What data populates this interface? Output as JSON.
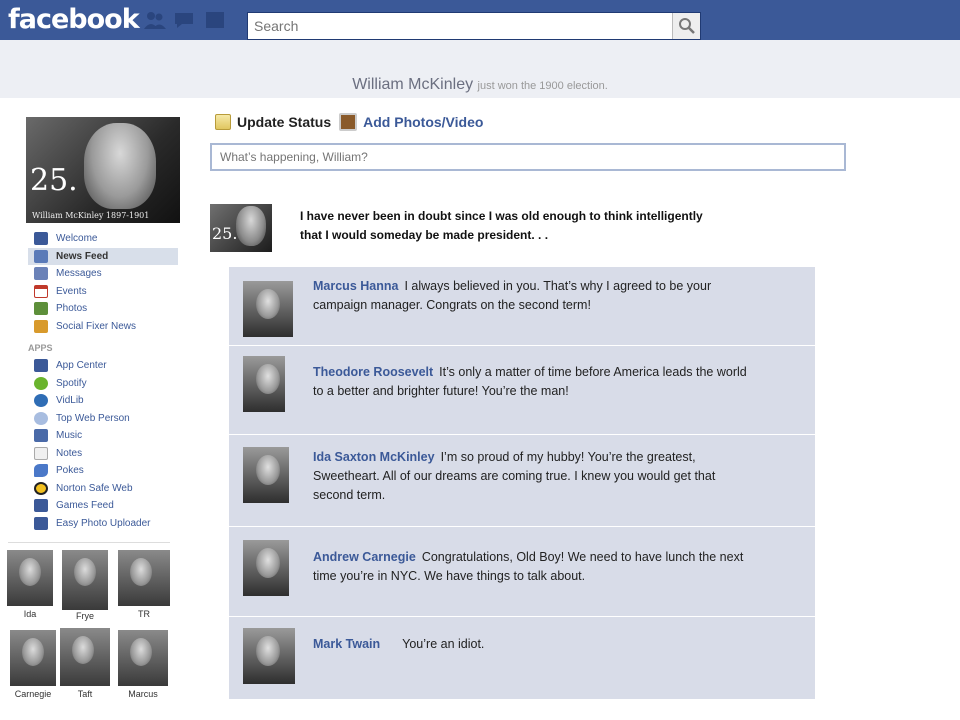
{
  "topbar": {
    "logo": "facebook",
    "search_placeholder": "Search",
    "bg_color": "#3b5998"
  },
  "headline": {
    "name": "William McKinley",
    "sub": "just won the 1900 election."
  },
  "profile": {
    "number": "25.",
    "caption": "William McKinley 1897-1901"
  },
  "nav": {
    "items": [
      {
        "label": "Welcome",
        "icon": "facebook-icon",
        "color": "#3b5998"
      },
      {
        "label": "News Feed",
        "icon": "news-feed-icon",
        "color": "#5a7ab8"
      },
      {
        "label": "Messages",
        "icon": "messages-icon",
        "color": "#6b82b8"
      },
      {
        "label": "Events",
        "icon": "calendar-icon",
        "color": "#c0392b"
      },
      {
        "label": "Photos",
        "icon": "photos-icon",
        "color": "#5d8f3a"
      },
      {
        "label": "Social Fixer News",
        "icon": "social-fixer-icon",
        "color": "#d89a2c"
      }
    ],
    "apps_heading": "APPS",
    "apps": [
      {
        "label": "App Center",
        "icon": "app-center-icon",
        "color": "#3b5998"
      },
      {
        "label": "Spotify",
        "icon": "spotify-icon",
        "color": "#6ab42d"
      },
      {
        "label": "VidLib",
        "icon": "vidlib-icon",
        "color": "#2f6db5"
      },
      {
        "label": "Top Web Person",
        "icon": "top-web-person-icon",
        "color": "#a8bde0"
      },
      {
        "label": "Music",
        "icon": "music-icon",
        "color": "#4a6aa8"
      },
      {
        "label": "Notes",
        "icon": "notes-icon",
        "color": "#d9d9d9"
      },
      {
        "label": "Pokes",
        "icon": "pokes-icon",
        "color": "#4a78c8"
      },
      {
        "label": "Norton Safe Web",
        "icon": "norton-icon",
        "color": "#f2c020"
      },
      {
        "label": "Games Feed",
        "icon": "games-feed-icon",
        "color": "#3b5998"
      },
      {
        "label": "Easy Photo Uploader",
        "icon": "photo-uploader-icon",
        "color": "#3b5998"
      }
    ]
  },
  "friends": [
    {
      "name": "Ida"
    },
    {
      "name": "Frye"
    },
    {
      "name": "TR"
    },
    {
      "name": "Carnegie"
    },
    {
      "name": "Taft"
    },
    {
      "name": "Marcus"
    }
  ],
  "composer": {
    "status_tab": "Update Status",
    "photos_tab": "Add Photos/Video",
    "placeholder": "What’s happening, William?"
  },
  "post": {
    "text": "I have never been in doubt since I was old enough to think intelligently that I would someday be made president. . ."
  },
  "comments": [
    {
      "author": "Marcus Hanna",
      "text": "I always believed in you.  That’s why I agreed to be your campaign manager.  Congrats on the second term!"
    },
    {
      "author": "Theodore Roosevelt",
      "text": "It’s only a matter of time before America leads the world to a better and brighter future! You’re the man!"
    },
    {
      "author": "Ida Saxton McKinley",
      "text": "I’m so proud of my hubby! You’re the greatest, Sweetheart. All of our dreams are coming true. I knew you would get that second term."
    },
    {
      "author": "Andrew Carnegie",
      "text": "Congratulations, Old Boy! We need to have lunch the next time you’re in NYC. We have things to talk about."
    },
    {
      "author": "Mark Twain",
      "text": "You’re an idiot."
    }
  ]
}
